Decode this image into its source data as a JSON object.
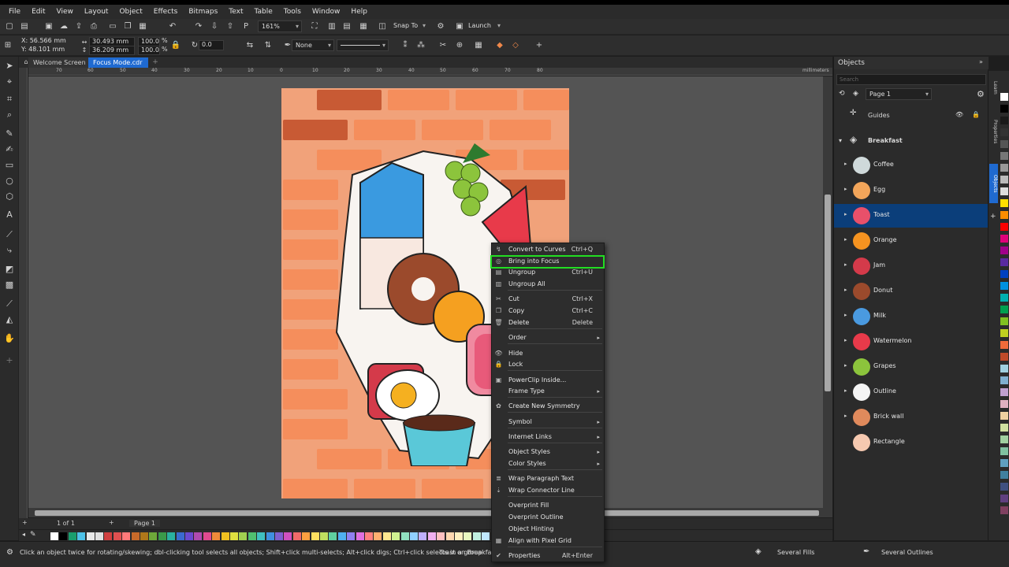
{
  "menu": [
    "File",
    "Edit",
    "View",
    "Layout",
    "Object",
    "Effects",
    "Bitmaps",
    "Text",
    "Table",
    "Tools",
    "Window",
    "Help"
  ],
  "toolbar": {
    "zoom": "161%",
    "snap_to": "Snap To",
    "launch": "Launch"
  },
  "property_bar": {
    "x": "X: 56.566 mm",
    "y": "Y: 48.101 mm",
    "width": "30.493 mm",
    "height": "36.209 mm",
    "scale_w": "100.0",
    "scale_h": "100.0",
    "pct1": "%",
    "pct2": "%",
    "rotation": "0.0",
    "outline_none": "None"
  },
  "doc_tabs": [
    "Welcome Screen",
    "Focus Mode.cdr"
  ],
  "ruler_ticks": [
    "70",
    "60",
    "50",
    "40",
    "30",
    "20",
    "10",
    "0",
    "10",
    "20",
    "30",
    "40",
    "50",
    "60",
    "70",
    "80"
  ],
  "ruler_unit": "millimeters",
  "page_nav": {
    "counter": "1   of   1",
    "page_tab": "Page 1"
  },
  "status": {
    "hint": "Click an object twice for rotating/skewing; dbl-clicking tool selects all objects; Shift+click multi-selects; Alt+click digs; Ctrl+click selects in a group",
    "selection": "Toast on Breakfast",
    "fill": "Several Fills",
    "outline": "Several Outlines"
  },
  "objects_panel": {
    "title": "Objects",
    "search_placeholder": "Search",
    "page": "Page 1",
    "guides": "Guides",
    "layer": "Breakfast",
    "items": [
      {
        "name": "Coffee",
        "color": "#cfd9da"
      },
      {
        "name": "Egg",
        "color": "#f2a55a"
      },
      {
        "name": "Toast",
        "color": "#e8506a"
      },
      {
        "name": "Orange",
        "color": "#f59320"
      },
      {
        "name": "Jam",
        "color": "#d43a4a"
      },
      {
        "name": "Donut",
        "color": "#9b4a2c"
      },
      {
        "name": "Milk",
        "color": "#4a9ae0"
      },
      {
        "name": "Watermelon",
        "color": "#e83a4a"
      },
      {
        "name": "Grapes",
        "color": "#8cc43c"
      },
      {
        "name": "Outline",
        "color": "#f4f4f4"
      },
      {
        "name": "Brick wall",
        "color": "#e08a5c"
      },
      {
        "name": "Rectangle",
        "color": "#f6c9b0"
      }
    ],
    "selected_index": 2
  },
  "side_tabs": [
    "Learn",
    "Properties",
    "Objects"
  ],
  "context_menu": {
    "items": [
      {
        "label": "Convert to Curves",
        "shortcut": "Ctrl+Q",
        "icon": "convert-curves-icon"
      },
      {
        "label": "Bring into Focus",
        "shortcut": "",
        "icon": "focus-icon",
        "highlight": true
      },
      {
        "label": "Ungroup",
        "shortcut": "Ctrl+U",
        "icon": "ungroup-icon"
      },
      {
        "label": "Ungroup All",
        "shortcut": "",
        "icon": "ungroup-all-icon"
      },
      {
        "label": "Cut",
        "shortcut": "Ctrl+X",
        "icon": "cut-icon"
      },
      {
        "label": "Copy",
        "shortcut": "Ctrl+C",
        "icon": "copy-icon"
      },
      {
        "label": "Delete",
        "shortcut": "Delete",
        "icon": "delete-icon"
      },
      {
        "label": "Order",
        "submenu": true
      },
      {
        "label": "Hide",
        "icon": "eye-icon"
      },
      {
        "label": "Lock",
        "icon": "lock-icon"
      },
      {
        "label": "PowerClip Inside...",
        "icon": "powerclip-icon"
      },
      {
        "label": "Frame Type",
        "submenu": true
      },
      {
        "label": "Create New Symmetry",
        "icon": "symmetry-icon"
      },
      {
        "label": "Symbol",
        "submenu": true
      },
      {
        "label": "Internet Links",
        "submenu": true
      },
      {
        "label": "Object Styles",
        "submenu": true
      },
      {
        "label": "Color Styles",
        "submenu": true
      },
      {
        "label": "Wrap Paragraph Text",
        "icon": "wrap-text-icon"
      },
      {
        "label": "Wrap Connector Line",
        "icon": "wrap-connector-icon"
      },
      {
        "label": "Overprint Fill"
      },
      {
        "label": "Overprint Outline"
      },
      {
        "label": "Object Hinting"
      },
      {
        "label": "Align with Pixel Grid",
        "icon": "pixel-grid-icon"
      },
      {
        "label": "Properties",
        "shortcut": "Alt+Enter",
        "icon": "check-icon"
      }
    ]
  },
  "palette_bottom": [
    "#ffffff",
    "#000000",
    "#1a9e6e",
    "#4ec2e8",
    "#e8e8e8",
    "#e0e0e0",
    "#d04040",
    "#e05050",
    "#ff7a7a",
    "#c86a2a",
    "#b0781a",
    "#6ea83a",
    "#3a9a4a",
    "#2ab0a0",
    "#3a6ad0",
    "#6a4ad0",
    "#b04ab0",
    "#e04a90",
    "#f08a3a",
    "#f0c020",
    "#e0e040",
    "#a0d050",
    "#50c070",
    "#40c0c0",
    "#4090e0",
    "#8060d0",
    "#d050c0",
    "#f06a6a",
    "#ffa040",
    "#ffe060",
    "#c0e060",
    "#60d0a0",
    "#50b0f0",
    "#9080f0",
    "#e070e0",
    "#ff8080",
    "#ffb070",
    "#ffe890",
    "#d0f090",
    "#90e0c0",
    "#90d0ff",
    "#c0b0ff",
    "#f0b0f0",
    "#ffc0c0",
    "#ffd8b0",
    "#fff0c0",
    "#e8f8c0",
    "#c0f0e0",
    "#c0e8ff",
    "#e0d8ff"
  ],
  "palette_right": [
    "#ffffff",
    "#000000",
    "#1a1a1a",
    "#333333",
    "#555555",
    "#777777",
    "#999999",
    "#bbbbbb",
    "#dddddd",
    "#ffe000",
    "#ff8c00",
    "#ff0000",
    "#e0007a",
    "#a0008a",
    "#5a2aa0",
    "#0040c0",
    "#0090e0",
    "#00b0b0",
    "#00a050",
    "#80c020",
    "#c0d020",
    "#f06a3a",
    "#c04a2a",
    "#a0d0e0",
    "#80b0d0",
    "#c0a0d0",
    "#e0b0c0",
    "#f0d0a0",
    "#d0e0a0",
    "#a0d0a0",
    "#80c0a0",
    "#60a0c0",
    "#4080a0",
    "#405080",
    "#604080",
    "#804060"
  ]
}
